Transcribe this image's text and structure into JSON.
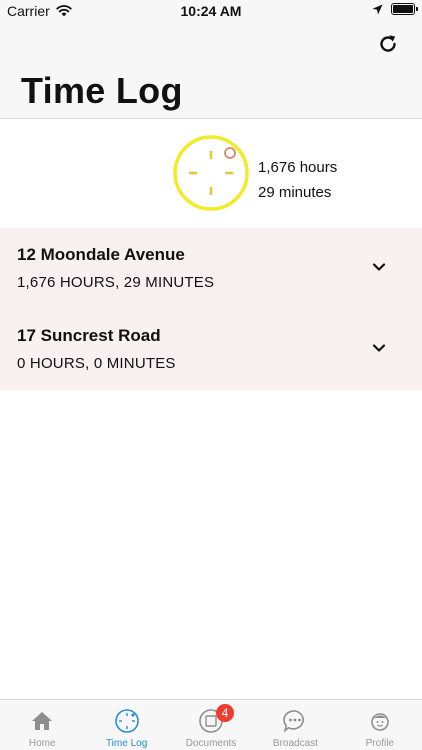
{
  "status_bar": {
    "carrier": "Carrier",
    "time": "10:24 AM"
  },
  "header": {
    "title": "Time Log"
  },
  "summary": {
    "hours": "1,676 hours",
    "minutes": "29 minutes"
  },
  "properties": [
    {
      "name": "12 Moondale Avenue",
      "total": "1,676 HOURS, 29 MINUTES"
    },
    {
      "name": "17 Suncrest Road",
      "total": "0 HOURS, 0 MINUTES"
    }
  ],
  "tabs": [
    {
      "label": "Home",
      "icon": "home-icon"
    },
    {
      "label": "Time Log",
      "icon": "clock-icon"
    },
    {
      "label": "Documents",
      "icon": "documents-icon",
      "badge": "4"
    },
    {
      "label": "Broadcast",
      "icon": "chat-bubble-icon"
    },
    {
      "label": "Profile",
      "icon": "profile-face-icon"
    }
  ],
  "colors": {
    "accent": "#2a8bd4",
    "clock": "#f3ea2a",
    "row_bg": "#f9f1f0",
    "badge": "#f03b30"
  }
}
